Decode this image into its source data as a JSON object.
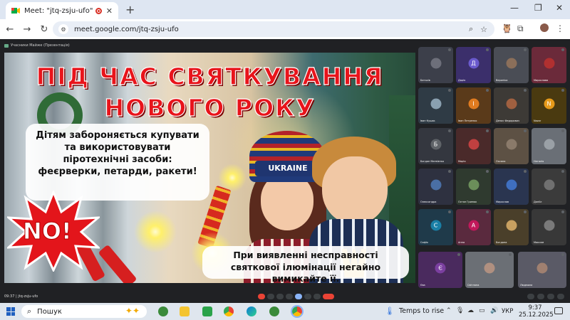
{
  "browser": {
    "tab_title": "Meet: \"jtq-zsju-ufo\"",
    "tab_close": "✕",
    "new_tab": "+",
    "url": "meet.google.com/jtq-zsju-ufo",
    "window_controls": [
      "—",
      "❐",
      "✕"
    ],
    "nav": {
      "back": "←",
      "forward": "→",
      "reload": "↻"
    },
    "toolbar_icons": [
      "⌕",
      "☆"
    ]
  },
  "meet": {
    "presenting_label": "Учасники Майже (Презентація)",
    "meeting_info": "09:37 | jtq-zsju-ufo",
    "slide": {
      "title_line1": "ПІД ЧАС СВЯТКУВАННЯ",
      "title_line2": "НОВОГО РОКУ",
      "box1_text": "Дітям забороняється купувати та використовувати піротехнічні засоби: феєрверки, петарди, ракети!",
      "box2_text": "При виявленні несправності святкової ілюмінації негайно вимикайте її.",
      "no_text": "NO!",
      "hat_text": "UKRAINE"
    },
    "participants": [
      {
        "initial": "",
        "name": "Батьків",
        "bg": "#3c3f4a",
        "avatar_bg": "#6d6f7a"
      },
      {
        "initial": "Д",
        "name": "Дарія",
        "bg": "#3b2f6b",
        "avatar_bg": "#6a5acd"
      },
      {
        "initial": "",
        "name": "Вероніка",
        "bg": "#4a4d55",
        "avatar_bg": "#8b6f5a"
      },
      {
        "initial": "",
        "name": "Мирослава",
        "bg": "#6b2a3a",
        "avatar_bg": "#b03030"
      },
      {
        "initial": "",
        "name": "Іван Кушак",
        "bg": "#2f3b45",
        "avatar_bg": "#8aa0b0"
      },
      {
        "initial": "І",
        "name": "Іван Петренко",
        "bg": "#5a3a1a",
        "avatar_bg": "#e07b20"
      },
      {
        "initial": "",
        "name": "Денис Федорович",
        "bg": "#3d3a36",
        "avatar_bg": "#a06040"
      },
      {
        "initial": "N",
        "name": "Nazar",
        "bg": "#4a3a10",
        "avatar_bg": "#e69a1a"
      },
      {
        "initial": "Б",
        "name": "Богдан Матвієнко",
        "bg": "#34373f",
        "avatar_bg": "#5f6368"
      },
      {
        "initial": "",
        "name": "Марія",
        "bg": "#4a2a2a",
        "avatar_bg": "#c04040"
      },
      {
        "initial": "",
        "name": "Оксана",
        "bg": "#5d5144",
        "avatar_bg": "#8a7a6a"
      },
      {
        "initial": "",
        "name": "Наталія",
        "bg": "#6a6f76",
        "avatar_bg": "#9aa0a6"
      },
      {
        "initial": "",
        "name": "Олександра",
        "bg": "#2e3140",
        "avatar_bg": "#4a6fa5"
      },
      {
        "initial": "",
        "name": "Остап Гринюк",
        "bg": "#2f3a2f",
        "avatar_bg": "#6b8e5a"
      },
      {
        "initial": "",
        "name": "Мирослав",
        "bg": "#2a3550",
        "avatar_bg": "#3f6fc0"
      },
      {
        "initial": "",
        "name": "Даніїл",
        "bg": "#3b3b3b",
        "avatar_bg": "#707070"
      },
      {
        "initial": "С",
        "name": "Софія",
        "bg": "#1f3a4a",
        "avatar_bg": "#1a7fa6"
      },
      {
        "initial": "А",
        "name": "Анна",
        "bg": "#5a2a3e",
        "avatar_bg": "#c2185b"
      },
      {
        "initial": "",
        "name": "Богдана",
        "bg": "#4a3f2a",
        "avatar_bg": "#c8a060"
      },
      {
        "initial": "",
        "name": "Максим",
        "bg": "#383838",
        "avatar_bg": "#7a7a7a"
      },
      {
        "initial": "Є",
        "name": "Єва",
        "bg": "#4a2a5e",
        "avatar_bg": "#7b3fa0"
      },
      {
        "initial": "",
        "name": "Світлана",
        "bg": "#6b6f75",
        "avatar_bg": "#b09080"
      },
      {
        "initial": "",
        "name": "Людмила",
        "bg": "#5a5a66",
        "avatar_bg": "#a08070"
      }
    ]
  },
  "taskbar": {
    "search_placeholder": "Пошук",
    "weather": "Temps to rise",
    "lang": "УКР",
    "time": "9:37",
    "date": "25.12.2025"
  },
  "colors": {
    "meet_bg": "#202124",
    "title_red": "#e8141b",
    "end_call": "#ea4335"
  }
}
